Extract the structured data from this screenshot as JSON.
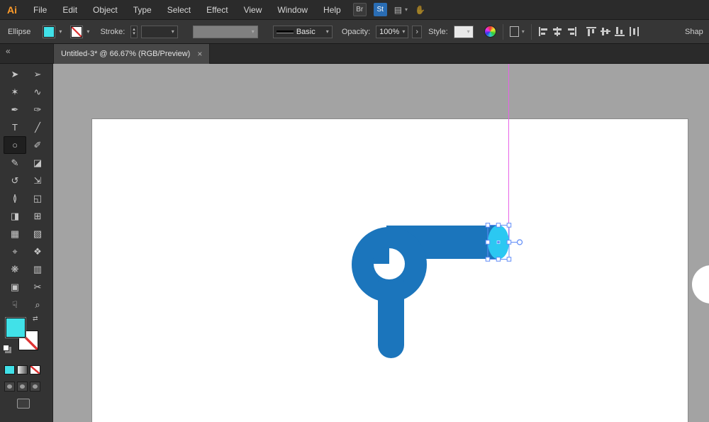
{
  "theme": {
    "ui_darkest": "#1e1e1e",
    "ui_dark": "#2b2b2b",
    "ui_mid": "#363636",
    "ui_panel": "#333333",
    "ui_tab": "#484848",
    "pasteboard": "#a3a3a3",
    "artboard": "#ffffff",
    "shape_blue": "#1b75bc",
    "ellipse_cyan": "#2bc8f2",
    "accent_cyan": "#41e1e8",
    "selection_blue": "#5f8cf8",
    "guide_magenta": "#e763e7",
    "stock_blue": "#2a6db4",
    "logo_orange": "#ff9c2a",
    "none_red": "#dd3333"
  },
  "menubar": {
    "logo": "Ai",
    "items": [
      "File",
      "Edit",
      "Object",
      "Type",
      "Select",
      "Effect",
      "View",
      "Window",
      "Help"
    ],
    "bridge": "Br",
    "stock": "St"
  },
  "controlbar": {
    "context": "Ellipse",
    "stroke_label": "Stroke:",
    "line_style": "Basic",
    "opacity_label": "Opacity:",
    "opacity_value": "100%",
    "style_label": "Style:",
    "shape_panel": "Shap"
  },
  "tab": {
    "title": "Untitled-3* @ 66.67% (RGB/Preview)"
  },
  "icons": {
    "collapse": "«",
    "close": "×",
    "chevron": "▾",
    "chevron_right": "›",
    "swap": "⇄",
    "step_up": "▴",
    "step_down": "▾",
    "arrange": "▤",
    "touch": "✋"
  },
  "toolbar": {
    "active_tool": "ellipse-tool",
    "tools": [
      {
        "name": "selection-tool",
        "glyph": "➤"
      },
      {
        "name": "direct-selection-tool",
        "glyph": "➢"
      },
      {
        "name": "magic-wand-tool",
        "glyph": "✶"
      },
      {
        "name": "lasso-tool",
        "glyph": "∿"
      },
      {
        "name": "pen-tool",
        "glyph": "✒"
      },
      {
        "name": "curvature-tool",
        "glyph": "✑"
      },
      {
        "name": "type-tool",
        "glyph": "T"
      },
      {
        "name": "line-segment-tool",
        "glyph": "╱"
      },
      {
        "name": "ellipse-tool",
        "glyph": "○"
      },
      {
        "name": "paintbrush-tool",
        "glyph": "✐"
      },
      {
        "name": "pencil-tool",
        "glyph": "✎"
      },
      {
        "name": "eraser-tool",
        "glyph": "◪"
      },
      {
        "name": "rotate-tool",
        "glyph": "↺"
      },
      {
        "name": "scale-tool",
        "glyph": "⇲"
      },
      {
        "name": "width-tool",
        "glyph": "≬"
      },
      {
        "name": "free-transform-tool",
        "glyph": "◱"
      },
      {
        "name": "shape-builder-tool",
        "glyph": "◨"
      },
      {
        "name": "perspective-grid-tool",
        "glyph": "⊞"
      },
      {
        "name": "mesh-tool",
        "glyph": "▦"
      },
      {
        "name": "gradient-tool",
        "glyph": "▧"
      },
      {
        "name": "eyedropper-tool",
        "glyph": "⌖"
      },
      {
        "name": "blend-tool",
        "glyph": "❖"
      },
      {
        "name": "symbol-sprayer-tool",
        "glyph": "❋"
      },
      {
        "name": "column-graph-tool",
        "glyph": "▥"
      },
      {
        "name": "artboard-tool",
        "glyph": "▣"
      },
      {
        "name": "slice-tool",
        "glyph": "✂"
      },
      {
        "name": "hand-tool",
        "glyph": "☟"
      },
      {
        "name": "zoom-tool",
        "glyph": "⌕"
      }
    ]
  }
}
